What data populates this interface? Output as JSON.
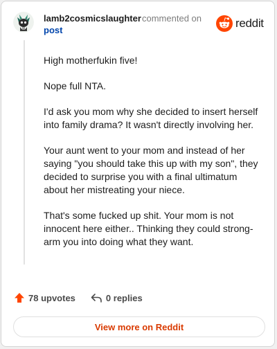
{
  "header": {
    "author": "lamb2cosmicslaughter",
    "action_text": "commented on",
    "link_text": "post",
    "brand": "reddit"
  },
  "comment": {
    "paragraphs": [
      "High motherfukin five!",
      "Nope full NTA.",
      "I'd ask you mom why she decided to insert herself into family drama? It wasn't directly involving her.",
      "Your aunt went to your mom and instead of her saying \"you should take this up with my son\", they decided to surprise you with a final ultimatum about her mistreating your niece.",
      "That's some fucked up shit. Your mom is not innocent here either.. Thinking they could strong-arm you into doing what they want."
    ]
  },
  "footer": {
    "upvotes": "78 upvotes",
    "replies": "0 replies",
    "view_more": "View more on Reddit"
  },
  "colors": {
    "accent": "#ff4500",
    "link": "#0045ac",
    "view_more": "#d93a00"
  }
}
